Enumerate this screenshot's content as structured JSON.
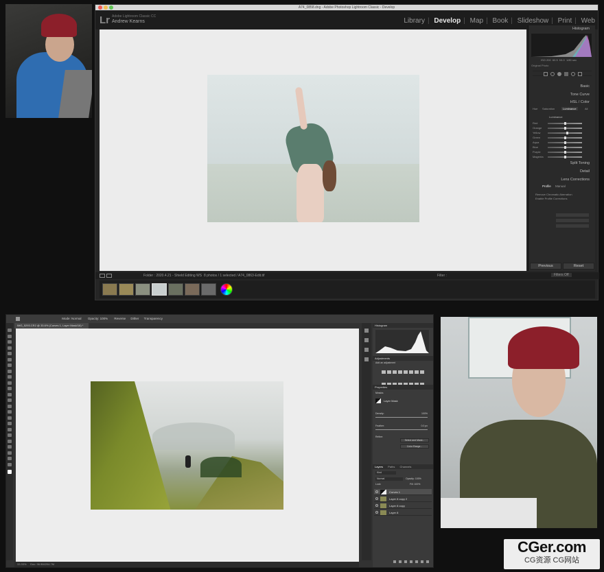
{
  "lightroom": {
    "window_title": "A74_0858.dng - Adobe Photoshop Lightroom Classic - Develop",
    "catalog_label": "Adobe Lightroom Classic CC",
    "user_name": "Andrew Kearns",
    "modules": [
      "Library",
      "Develop",
      "Map",
      "Book",
      "Slideshow",
      "Print",
      "Web"
    ],
    "active_module": "Develop",
    "histogram_label": "Histogram",
    "histogram_readout": [
      "ISO 200",
      "60.5",
      "f/4.0",
      "1/80 sec"
    ],
    "original_photo_label": "Original Photo",
    "panels": {
      "basic": "Basic",
      "tone_curve": "Tone Curve",
      "hsl": "HSL / Color",
      "hsl_tabs": [
        "Hue",
        "Saturation",
        "Luminance",
        "All"
      ],
      "hsl_active_tab": "Luminance",
      "luminance_title": "Luminance",
      "colors": [
        "Red",
        "Orange",
        "Yellow",
        "Green",
        "Aqua",
        "Blue",
        "Purple",
        "Magenta"
      ],
      "color_levels": [
        0.5,
        0.5,
        0.55,
        0.5,
        0.5,
        0.5,
        0.5,
        0.5
      ],
      "split_toning": "Split Toning",
      "detail": "Detail",
      "lens_corrections": "Lens Corrections",
      "lens_tabs": [
        "Profile",
        "Manual"
      ],
      "lens_options": [
        "Remove Chromatic Aberration",
        "Enable Profile Corrections"
      ],
      "previous_button": "Previous",
      "reset_button": "Reset"
    },
    "toolbar": {
      "folder_text": "Folder : 2020.4.21 - Shield Editing WS",
      "count_text": "8 photos / 1 selected / A74_0863-Edit.tif",
      "filter_label": "Filter :",
      "filters_off": "Filters Off"
    }
  },
  "photoshop": {
    "options_bar": [
      "Mode:",
      "Normal",
      "Opacity:",
      "100%",
      "Reverse",
      "Dither",
      "Transparency"
    ],
    "doc_tab": "IMG_5293.CR2 @ 33.6% (Curves 1, Layer Mask/16) *",
    "status_bar": [
      "33.33%",
      "Doc: 96.9M/204.7M"
    ],
    "histogram_label": "Histogram",
    "adjustments_label": "Adjustments",
    "add_adjustment": "Add an adjustment",
    "properties_label": "Properties",
    "masks_label": "Masks",
    "layer_mask_label": "Layer Mask",
    "density_label": "Density:",
    "density_value": "100%",
    "feather_label": "Feather:",
    "feather_value": "0.0 px",
    "refine_label": "Refine:",
    "select_mask_button": "Select and Mask...",
    "color_range_button": "Color Range...",
    "layers_tabs": [
      "Layers",
      "Paths",
      "Channels"
    ],
    "kind_label": "Kind",
    "blend_mode": "Normal",
    "opacity_label": "Opacity:",
    "opacity_value": "100%",
    "lock_label": "Lock:",
    "fill_label": "Fill:",
    "fill_value": "100%",
    "layers": [
      "Curves 1",
      "Layer 8 copy 2",
      "Layer 8 copy",
      "Layer 8"
    ]
  },
  "watermark": {
    "main": "CGer.com",
    "sub": "CG资源 CG网站"
  }
}
